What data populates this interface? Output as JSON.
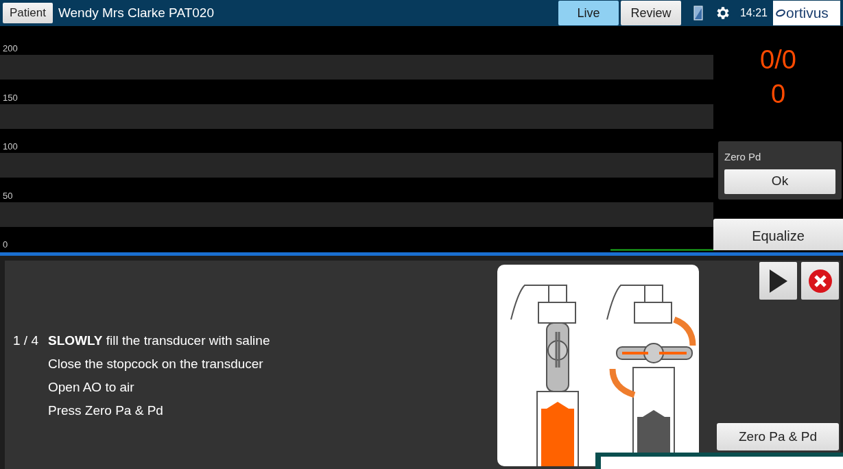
{
  "header": {
    "patient_button": "Patient",
    "patient_name": "Wendy Mrs Clarke PAT020",
    "tabs": [
      {
        "label": "Live",
        "selected": true
      },
      {
        "label": "Review",
        "selected": false
      }
    ],
    "time": "14:21",
    "logo": "ortivus"
  },
  "trend": {
    "y_labels": [
      "200",
      "150",
      "100",
      "50",
      "0"
    ]
  },
  "readings": {
    "ratio": "0/0",
    "value": "0"
  },
  "zero_panel": {
    "title": "Zero Pd",
    "button": "Ok"
  },
  "equalize_button": "Equalize",
  "instructions": {
    "step": "1 / 4",
    "lines": [
      "**SLOWLY** fill the transducer with saline",
      "Close the stopcock on the transducer",
      "Open AO to air",
      "Press Zero Pa & Pd"
    ]
  },
  "zero_button": "Zero Pa & Pd"
}
